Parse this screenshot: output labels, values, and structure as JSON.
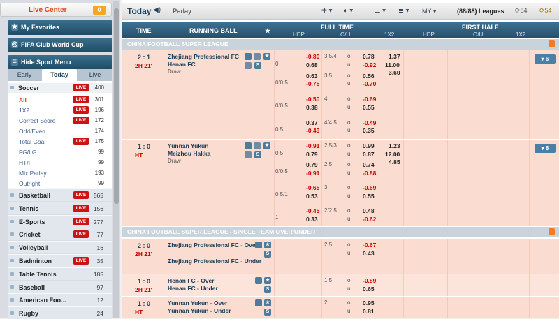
{
  "sidebar": {
    "live_center": {
      "label": "Live Center",
      "count": "0"
    },
    "favorites": "My Favorites",
    "cup": "FIFA Club World Cup",
    "hide_menu": "Hide Sport Menu",
    "tabs": [
      "Early",
      "Today",
      "Live"
    ],
    "soccer": {
      "label": "Soccer",
      "live": "LIVE",
      "count": "400"
    },
    "soccer_items": [
      {
        "label": "All",
        "live": "LIVE",
        "count": "301"
      },
      {
        "label": "1X2",
        "live": "LIVE",
        "count": "196"
      },
      {
        "label": "Correct Score",
        "live": "LIVE",
        "count": "172"
      },
      {
        "label": "Odd/Even",
        "live": "",
        "count": "174"
      },
      {
        "label": "Total Goal",
        "live": "LIVE",
        "count": "175"
      },
      {
        "label": "FG/LG",
        "live": "",
        "count": "99"
      },
      {
        "label": "HT/FT",
        "live": "",
        "count": "99"
      },
      {
        "label": "Mix Parlay",
        "live": "",
        "count": "193"
      },
      {
        "label": "Outright",
        "live": "",
        "count": "99"
      }
    ],
    "sports": [
      {
        "label": "Basketball",
        "live": "LIVE",
        "count": "565"
      },
      {
        "label": "Tennis",
        "live": "LIVE",
        "count": "156"
      },
      {
        "label": "E-Sports",
        "live": "LIVE",
        "count": "277"
      },
      {
        "label": "Cricket",
        "live": "LIVE",
        "count": "77"
      },
      {
        "label": "Volleyball",
        "live": "",
        "count": "16"
      },
      {
        "label": "Badminton",
        "live": "LIVE",
        "count": "35"
      },
      {
        "label": "Table Tennis",
        "live": "",
        "count": "185"
      },
      {
        "label": "Baseball",
        "live": "",
        "count": "97"
      },
      {
        "label": "American Foo...",
        "live": "",
        "count": "12"
      },
      {
        "label": "Rugby",
        "live": "",
        "count": "24"
      }
    ]
  },
  "topbar": {
    "title": "Today",
    "mode": "Parlay",
    "odds_type": "MY",
    "leagues": "(88/88) Leagues",
    "count1": "84",
    "count2": "54"
  },
  "header": {
    "time": "TIME",
    "running_ball": "RUNNING BALL",
    "full_time": "FULL TIME",
    "first_half": "FIRST HALF",
    "hdp": "HDP",
    "ou": "O/U",
    "x12": "1X2"
  },
  "league1": "CHINA FOOTBALL SUPER LEAGUE",
  "match1": {
    "score": "2 : 1",
    "time": "2H 21'",
    "home": "Zhejiang Professional FC",
    "away": "Henan FC",
    "draw": "Draw",
    "more": "6",
    "rows": [
      {
        "hdp": "",
        "h1": "-0.80",
        "h2": "0.68",
        "ou": "3.5/4",
        "ou2": "",
        "o1": "0.78",
        "o2": "-0.92",
        "x1": "1.37",
        "x2": "11.00",
        "x3": "3.60",
        "hdpline": "0"
      },
      {
        "hdp": "",
        "h1": "0.63",
        "h2": "-0.75",
        "ou": "3.5",
        "o1": "0.56",
        "o2": "-0.70",
        "hdpline": "0/0.5"
      },
      {
        "hdp": "",
        "h1": "-0.50",
        "h2": "0.38",
        "ou": "4",
        "o1": "-0.69",
        "o2": "0.55",
        "hdpline": "0/0.5"
      },
      {
        "hdp": "",
        "h1": "0.37",
        "h2": "-0.49",
        "ou": "4/4.5",
        "o1": "-0.49",
        "o2": "0.35",
        "hdpline": "0.5"
      }
    ]
  },
  "match2": {
    "score": "1 : 0",
    "time": "HT",
    "home": "Yunnan Yukun",
    "away": "Meizhou Hakka",
    "draw": "Draw",
    "more": "8",
    "rows": [
      {
        "h1": "-0.91",
        "h2": "0.79",
        "ou": "2.5/3",
        "o1": "0.99",
        "o2": "0.87",
        "x1": "1.23",
        "x2": "12.00",
        "x3": "4.85",
        "hdpline": "0.5"
      },
      {
        "h1": "0.79",
        "h2": "-0.91",
        "ou": "2.5",
        "o1": "0.74",
        "o2": "-0.88",
        "hdpline": "0/0.5"
      },
      {
        "h1": "-0.65",
        "h2": "0.53",
        "ou": "3",
        "o1": "-0.69",
        "o2": "0.55",
        "hdpline": "0.5/1"
      },
      {
        "h1": "-0.45",
        "h2": "0.33",
        "ou": "2/2.5",
        "o1": "0.48",
        "o2": "-0.62",
        "hdpline": "1"
      }
    ]
  },
  "league2": "CHINA FOOTBALL SUPER LEAGUE - SINGLE TEAM OVER/UNDER",
  "single": [
    {
      "score": "2 : 0",
      "time": "2H 21'",
      "over": "Zhejiang Professional FC - Over",
      "under": "Zhejiang Professional FC - Under",
      "ou": "2.5",
      "o1": "-0.67",
      "o2": "0.43"
    },
    {
      "score": "1 : 0",
      "time": "2H 21'",
      "over": "Henan FC - Over",
      "under": "Henan FC - Under",
      "ou": "1.5",
      "o1": "-0.89",
      "o2": "0.65"
    },
    {
      "score": "1 : 0",
      "time": "HT",
      "over": "Yunnan Yukun - Over",
      "under": "Yunnan Yukun - Under",
      "ou": "2",
      "o1": "0.95",
      "o2": "0.81"
    }
  ],
  "colors": {
    "accent": "#cc1414",
    "header": "#2d5a79",
    "row": "#fbdcd0"
  }
}
